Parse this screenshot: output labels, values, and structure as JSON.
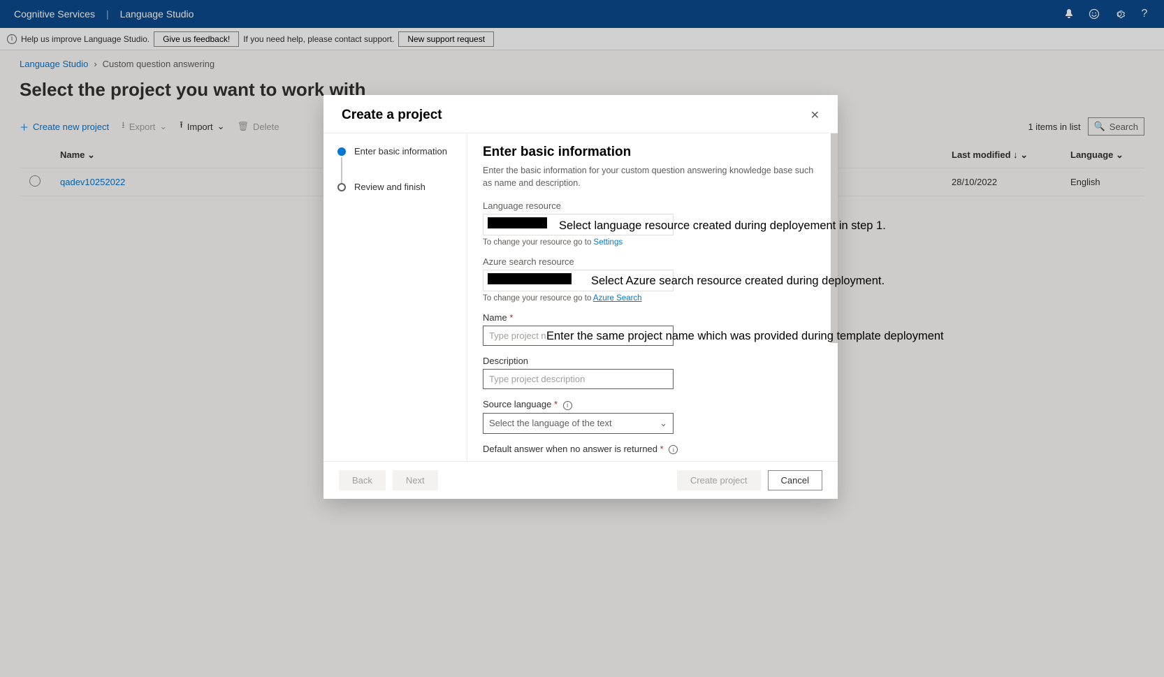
{
  "topnav": {
    "brand": "Cognitive Services",
    "product": "Language Studio"
  },
  "feedback": {
    "help_text": "Help us improve Language Studio.",
    "feedback_btn": "Give us feedback!",
    "support_text": "If you need help, please contact support.",
    "support_btn": "New support request"
  },
  "breadcrumb": {
    "root": "Language Studio",
    "current": "Custom question answering"
  },
  "page_title": "Select the project you want to work with",
  "toolbar": {
    "create": "Create new project",
    "export": "Export",
    "import": "Import",
    "delete": "Delete",
    "items_count": "1 items in list",
    "search": "Search"
  },
  "table": {
    "headers": {
      "name": "Name",
      "last_modified": "Last modified",
      "language": "Language"
    },
    "rows": [
      {
        "name": "qadev10252022",
        "last_modified": "28/10/2022",
        "language": "English"
      }
    ]
  },
  "modal": {
    "title": "Create a project",
    "steps": {
      "s1": "Enter basic information",
      "s2": "Review and finish"
    },
    "panel": {
      "heading": "Enter basic information",
      "desc": "Enter the basic information for your custom question answering knowledge base such as name and description.",
      "lang_resource_label": "Language resource",
      "lang_resource_hint_prefix": "To change your resource go to ",
      "lang_resource_hint_link": "Settings",
      "azure_search_label": "Azure search resource",
      "azure_search_hint_prefix": "To change your resource go to ",
      "azure_search_hint_link": "Azure Search",
      "name_label": "Name",
      "name_placeholder": "Type project n",
      "description_label": "Description",
      "description_placeholder": "Type project description",
      "source_lang_label": "Source language",
      "source_lang_placeholder": "Select the language of the text",
      "default_answer_label": "Default answer when no answer is returned"
    },
    "footer": {
      "back": "Back",
      "next": "Next",
      "create": "Create project",
      "cancel": "Cancel"
    }
  },
  "annotations": {
    "a1": "Select language resource created during deployement in step 1.",
    "a2": "Select Azure search resource created during deployment.",
    "a3": "Enter the same project name which was provided during template deployment"
  }
}
